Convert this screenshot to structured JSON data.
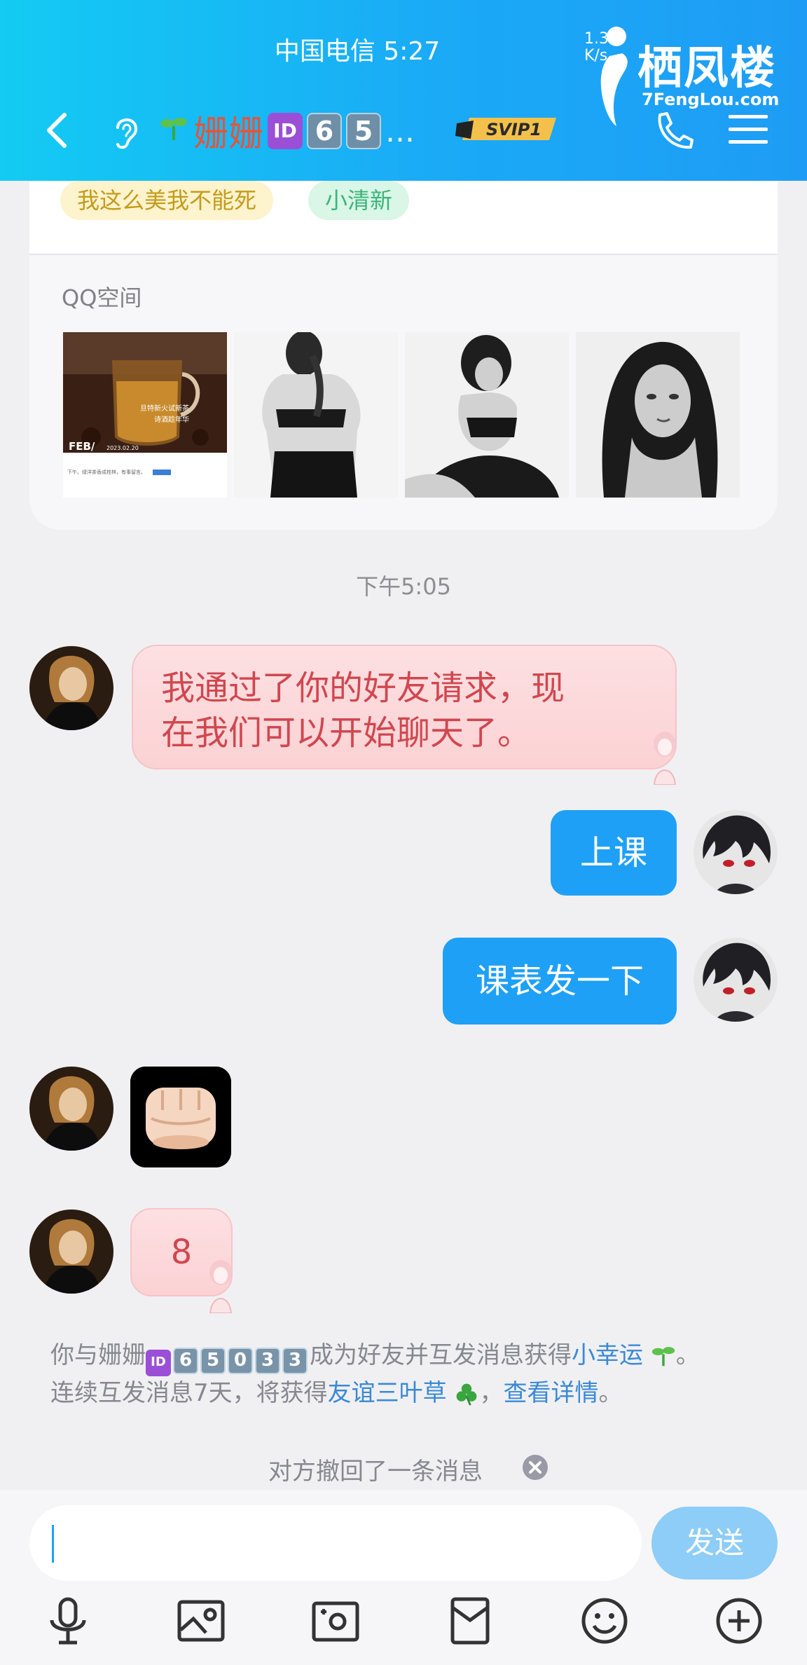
{
  "status": {
    "carrier_time": "中国电信 5:27",
    "speed": "1.3\nK/s"
  },
  "watermark": {
    "title": "栖凤楼",
    "url": "7FengLou.com"
  },
  "header": {
    "name": "姗姗",
    "badge_id": "ID",
    "badge_digits": [
      "6",
      "5"
    ],
    "ellipsis": "…",
    "svip_label": "SVIP1"
  },
  "profile": {
    "tags": [
      "我这么美我不能死",
      "小清新"
    ],
    "space_title": "QQ空间",
    "photo1_text": {
      "overlay": "旦特新火试新茶\n诗酒趁年华",
      "month": "FEB/",
      "date": "2023.02.20",
      "caption": "下午。绿洋茶香成桂林，有事留言"
    }
  },
  "chat": {
    "timestamp": "下午5:05",
    "msg_friend_accept": "我通过了你的好友请求，现在我们可以开始聊天了。",
    "msg_class": "上课",
    "msg_schedule": "课表发一下",
    "msg_eight": "8"
  },
  "system": {
    "line1_prefix": "你与姗姗",
    "badge_id": "ID",
    "digits": [
      "6",
      "5",
      "0",
      "3",
      "3"
    ],
    "line1_mid": "成为好友并互发消息获得",
    "lucky_link": "小幸运",
    "line1_end": "。",
    "line2_prefix": "连续互发消息7天，将获得",
    "clover_link": "友谊三叶草",
    "line2_mid": "，",
    "details_link": "查看详情",
    "line2_end": "。",
    "recall": "对方撤回了一条消息"
  },
  "input": {
    "send_label": "发送"
  },
  "toolbar": [
    "mic-icon",
    "image-icon",
    "camera-icon",
    "redpacket-icon",
    "emoji-icon",
    "plus-icon"
  ],
  "colors": {
    "accent": "#1ea0f6",
    "name": "#e2553e",
    "link": "#3a89d6",
    "pink_text": "#d0474f"
  }
}
